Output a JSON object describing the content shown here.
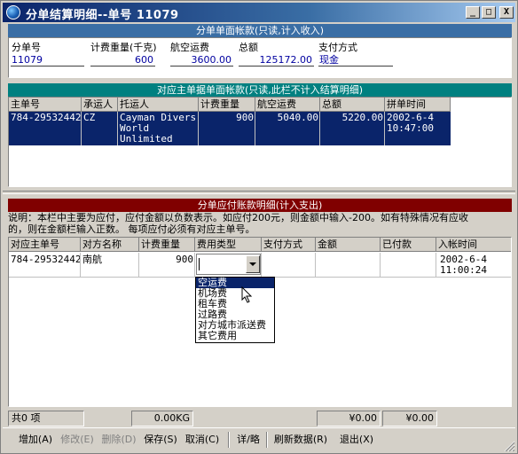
{
  "window": {
    "title": "分单结算明细--单号 11079",
    "min_label": "_",
    "max_label": "□",
    "close_label": "X"
  },
  "summary": {
    "header": "分单单面帐款(只读,计入收入)",
    "fields": [
      {
        "label": "分单号",
        "value": "11079"
      },
      {
        "label": "计费重量(千克)",
        "value": "600"
      },
      {
        "label": "航空运费",
        "value": "3600.00"
      },
      {
        "label": "总额",
        "value": "125172.00"
      },
      {
        "label": "支付方式",
        "value": "现金"
      }
    ]
  },
  "master": {
    "header": "对应主单据单面帐款(只读,此栏不计入结算明细)",
    "columns": [
      "主单号",
      "承运人",
      "托运人",
      "计费重量",
      "航空运费",
      "总额",
      "拼单时间"
    ],
    "row": {
      "master_no": "784-29532442",
      "carrier": "CZ",
      "shipper_lines": [
        "Cayman Divers",
        "World",
        "Unlimited"
      ],
      "weight": "900",
      "air_freight": "5040.00",
      "total": "5220.00",
      "time_lines": [
        "2002-6-4",
        "10:47:00"
      ]
    }
  },
  "payables": {
    "header": "分单应付账款明细(计入支出)",
    "note_line1": "  说明：本栏中主要为应付，应付金额以负数表示。如应付200元，则金额中输入-200。如有特殊情况有应收",
    "note_line2": "的，则在金额栏输入正数。  每项应付必须有对应主单号。",
    "columns": [
      "对应主单号",
      "对方名称",
      "计费重量",
      "费用类型",
      "支付方式",
      "金额",
      "已付款",
      "入帐时间"
    ],
    "row": {
      "master_no": "784-29532442",
      "party": "南航",
      "weight": "900",
      "fee_type": "",
      "pay_method": "",
      "amount": "",
      "paid": "",
      "time_lines": [
        "2002-6-4",
        "11:00:24"
      ]
    },
    "fee_type_options": [
      "空运费",
      "机场费",
      "租车费",
      "过路费",
      "对方城市派送费",
      "其它费用"
    ],
    "selected_option_index": 0
  },
  "status": {
    "count": "共0 项",
    "weight_total": "0.00KG",
    "amount_total": "¥0.00",
    "paid_total": "¥0.00"
  },
  "toolbar": {
    "add": "增加(A)",
    "modify": "修改(E)",
    "delete": "删除(D)",
    "save": "保存(S)",
    "cancel": "取消(C)",
    "detail": "详/略",
    "refresh": "刷新数据(R)",
    "exit": "退出(X)"
  },
  "colors": {
    "titlebar": "#0a246a",
    "summary_bar": "#3a6ea5",
    "master_bar": "#008080",
    "payables_bar": "#800000",
    "selection": "#0a246a"
  }
}
